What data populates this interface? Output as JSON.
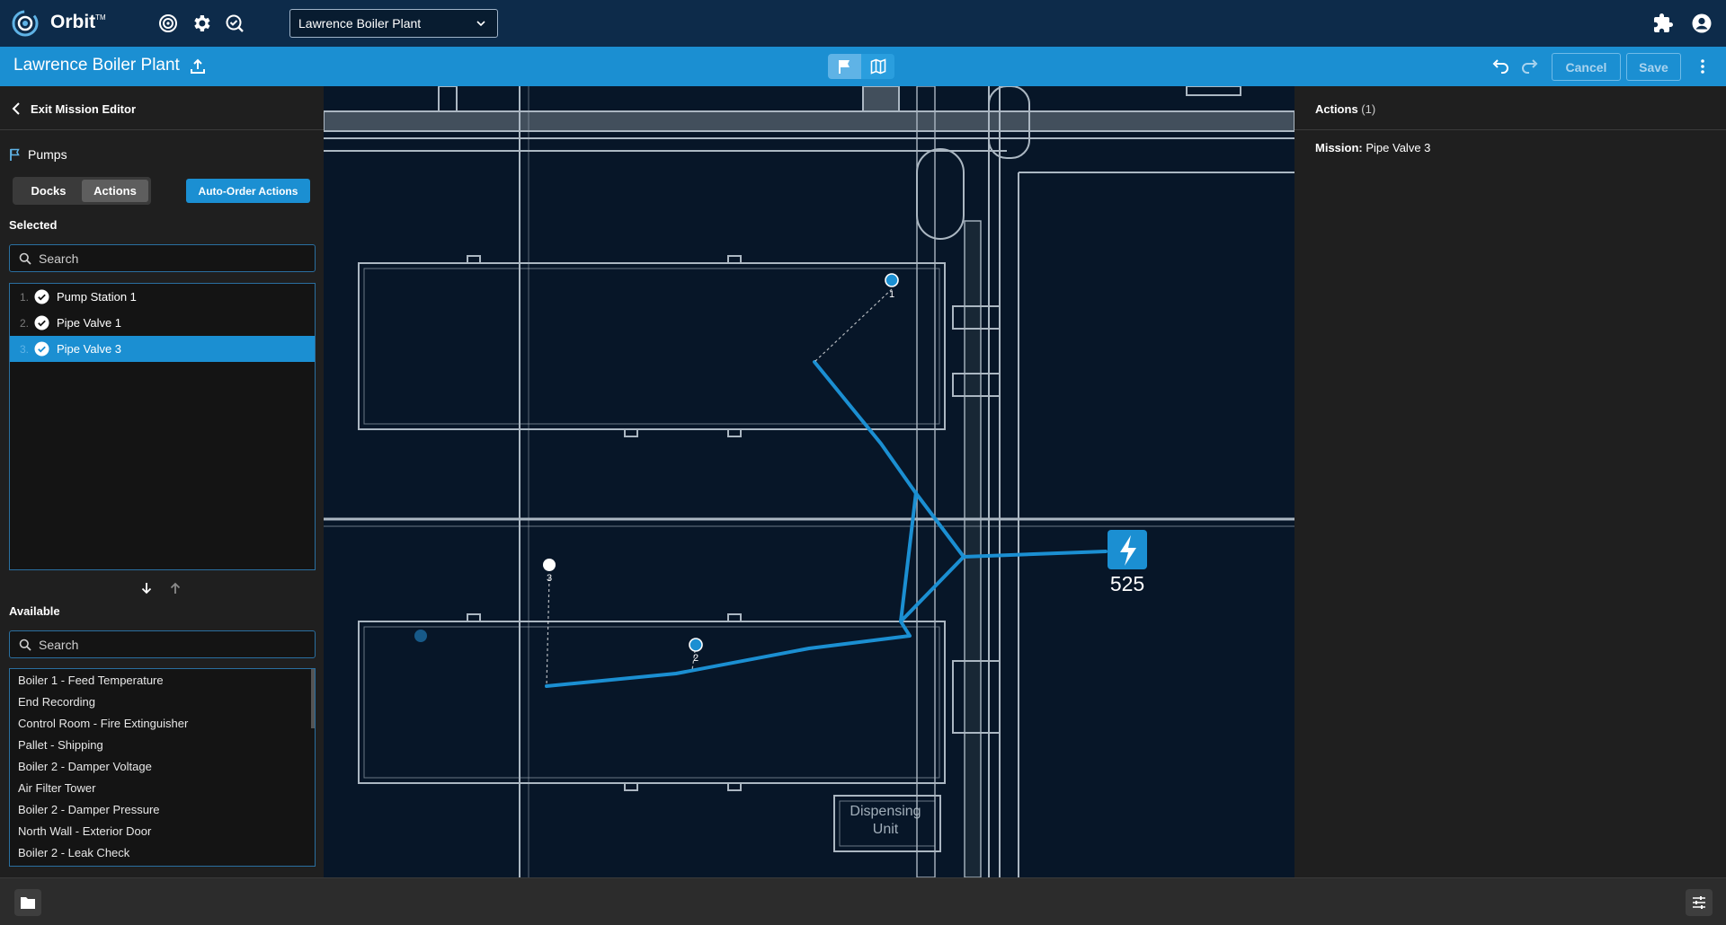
{
  "app": {
    "brand": "Orbit",
    "trademark": "TM"
  },
  "topbar": {
    "site_selector": "Lawrence Boiler Plant",
    "icons": [
      "target-icon",
      "gear-icon",
      "search-check-icon",
      "puzzle-icon",
      "account-icon"
    ]
  },
  "subbar": {
    "title": "Lawrence Boiler Plant",
    "cancel_label": "Cancel",
    "save_label": "Save",
    "view_modes": [
      "flag-icon",
      "map-icon"
    ]
  },
  "left": {
    "exit_label": "Exit Mission Editor",
    "group_label": "Pumps",
    "tabs": [
      {
        "label": "Docks"
      },
      {
        "label": "Actions"
      }
    ],
    "active_tab": "Actions",
    "auto_order_label": "Auto-Order Actions",
    "selected_label": "Selected",
    "selected_search_placeholder": "Search",
    "selected": [
      {
        "num": "1.",
        "label": "Pump Station 1"
      },
      {
        "num": "2.",
        "label": "Pipe Valve 1"
      },
      {
        "num": "3.",
        "label": "Pipe Valve 3"
      }
    ],
    "active_selected_index": 2,
    "available_label": "Available",
    "available_search_placeholder": "Search",
    "available": [
      "Boiler 1 - Feed Temperature",
      "End Recording",
      "Control Room - Fire Extinguisher",
      "Pallet - Shipping",
      "Boiler 2 - Damper Voltage",
      "Air Filter Tower",
      "Boiler 2 - Damper Pressure",
      "North Wall - Exterior Door",
      "Boiler 2 - Leak Check"
    ]
  },
  "map": {
    "waypoints": [
      {
        "label": "1"
      },
      {
        "label": "2"
      },
      {
        "label": "3"
      }
    ],
    "dock_label": "525",
    "blueprint_text": [
      "Dispensing",
      "Unit"
    ],
    "route_color": "#1b8fd2"
  },
  "right": {
    "title": "Actions",
    "count": "(1)",
    "mission_key": "Mission:",
    "mission_value": "Pipe Valve 3"
  },
  "colors": {
    "topbar": "#0d2b4a",
    "accent": "#1b8fd2",
    "panel": "#1f1f1f",
    "map_bg": "#071628"
  }
}
